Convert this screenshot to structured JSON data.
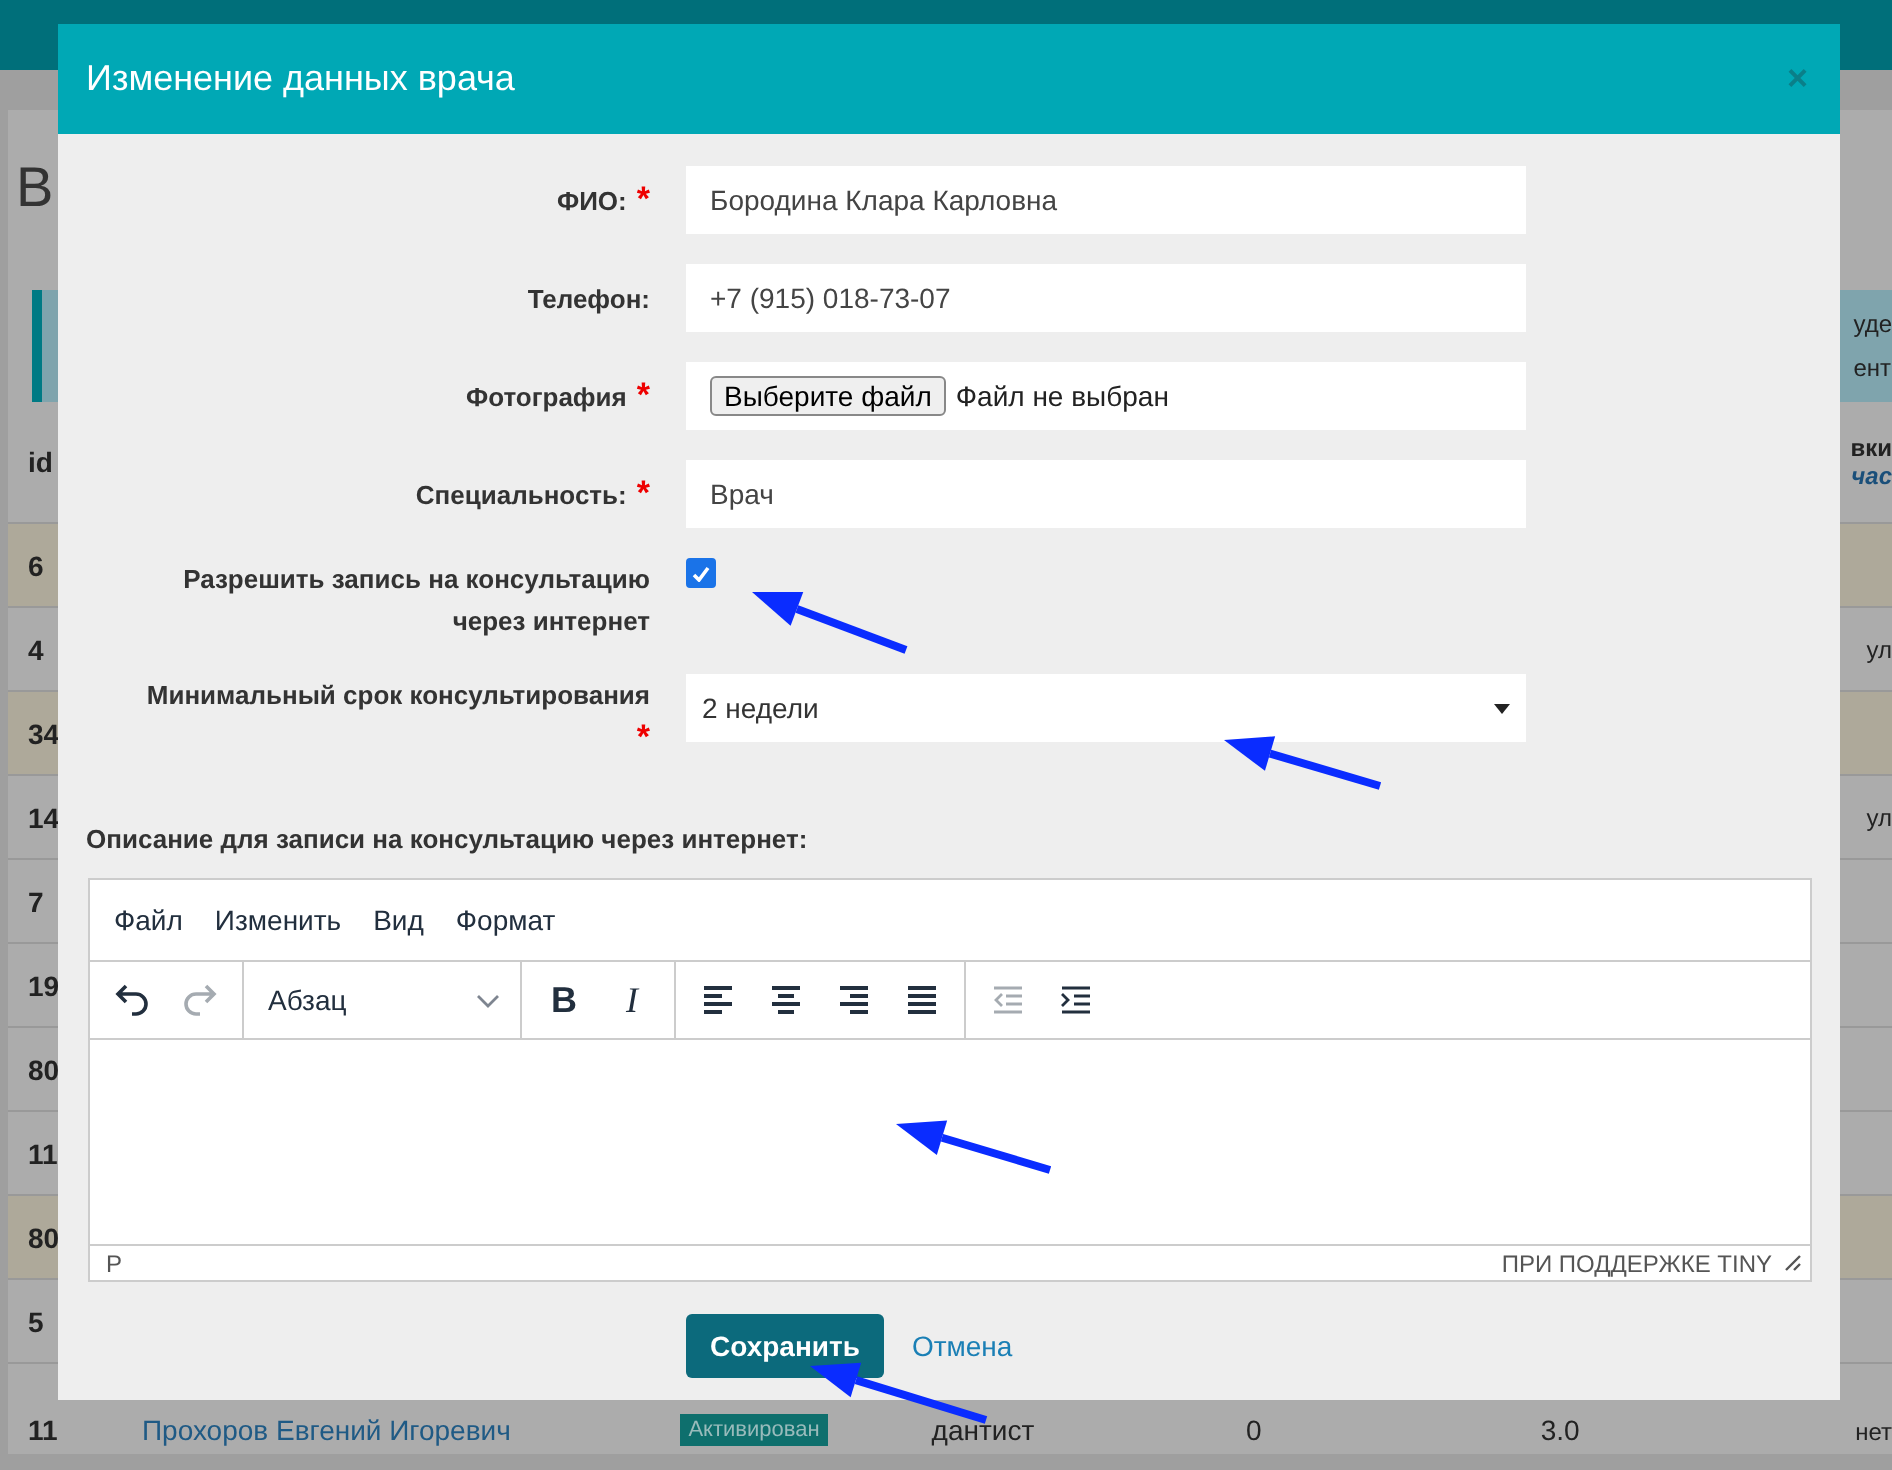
{
  "background_page": {
    "heading": "В",
    "info_lines": [
      "уде",
      "ент"
    ],
    "table": {
      "id_header": "id",
      "end_header": "вки",
      "end_header_link": "час",
      "rows": [
        {
          "id": "6",
          "highlighted": true
        },
        {
          "id": "4",
          "highlighted": false,
          "end": "ул"
        },
        {
          "id": "34",
          "highlighted": true
        },
        {
          "id": "14",
          "highlighted": false,
          "end": "ул"
        },
        {
          "id": "7",
          "highlighted": false
        },
        {
          "id": "19",
          "highlighted": false
        },
        {
          "id": "80",
          "highlighted": false
        },
        {
          "id": "11",
          "highlighted": false
        },
        {
          "id": "80",
          "highlighted": true
        },
        {
          "id": "5",
          "highlighted": false
        },
        {
          "id": "11",
          "highlighted": false,
          "name": "Прохоров Евгений Игоревич",
          "status": "Активирован",
          "specialty": "дантист",
          "column_5": "0",
          "column_6": "3.0",
          "end": "нет"
        }
      ]
    }
  },
  "modal": {
    "title": "Изменение данных врача",
    "close": "×",
    "fields": [
      {
        "kind": "text",
        "label": "ФИО:",
        "required_mark": "*",
        "value": "Бородина Клара Карловна"
      },
      {
        "kind": "text",
        "label": "Телефон:",
        "value": "+7 (915) 018-73-07"
      },
      {
        "kind": "file",
        "label": "Фотография",
        "required_mark": "*",
        "button": "Выберите файл",
        "status": "Файл не выбран"
      },
      {
        "kind": "text",
        "label": "Специальность:",
        "required_mark": "*",
        "value": "Врач"
      },
      {
        "kind": "checkbox",
        "label": "Разрешить запись на консультацию через интернет",
        "checked": true
      },
      {
        "kind": "select",
        "label": "Минимальный срок консультирования",
        "required_mark": "*",
        "value": "2 недели"
      }
    ],
    "description_label": "Описание для записи на консультацию через интернет:",
    "editor": {
      "menu": [
        "Файл",
        "Изменить",
        "Вид",
        "Формат"
      ],
      "toolbar": [
        [
          {
            "kind": "undo",
            "disabled": false
          },
          {
            "kind": "redo",
            "disabled": true
          }
        ],
        [
          {
            "kind": "format_select",
            "label": "Абзац"
          }
        ],
        [
          {
            "kind": "bold",
            "label": "B"
          },
          {
            "kind": "italic",
            "label": "I"
          }
        ],
        [
          {
            "kind": "align_left"
          },
          {
            "kind": "align_center"
          },
          {
            "kind": "align_right"
          },
          {
            "kind": "justify"
          }
        ],
        [
          {
            "kind": "outdent",
            "disabled": true
          },
          {
            "kind": "indent",
            "disabled": false
          }
        ]
      ],
      "path": "P",
      "branding": "ПРИ ПОДДЕРЖКЕ TINY"
    },
    "save_button": "Сохранить",
    "cancel_link": "Отмена"
  }
}
